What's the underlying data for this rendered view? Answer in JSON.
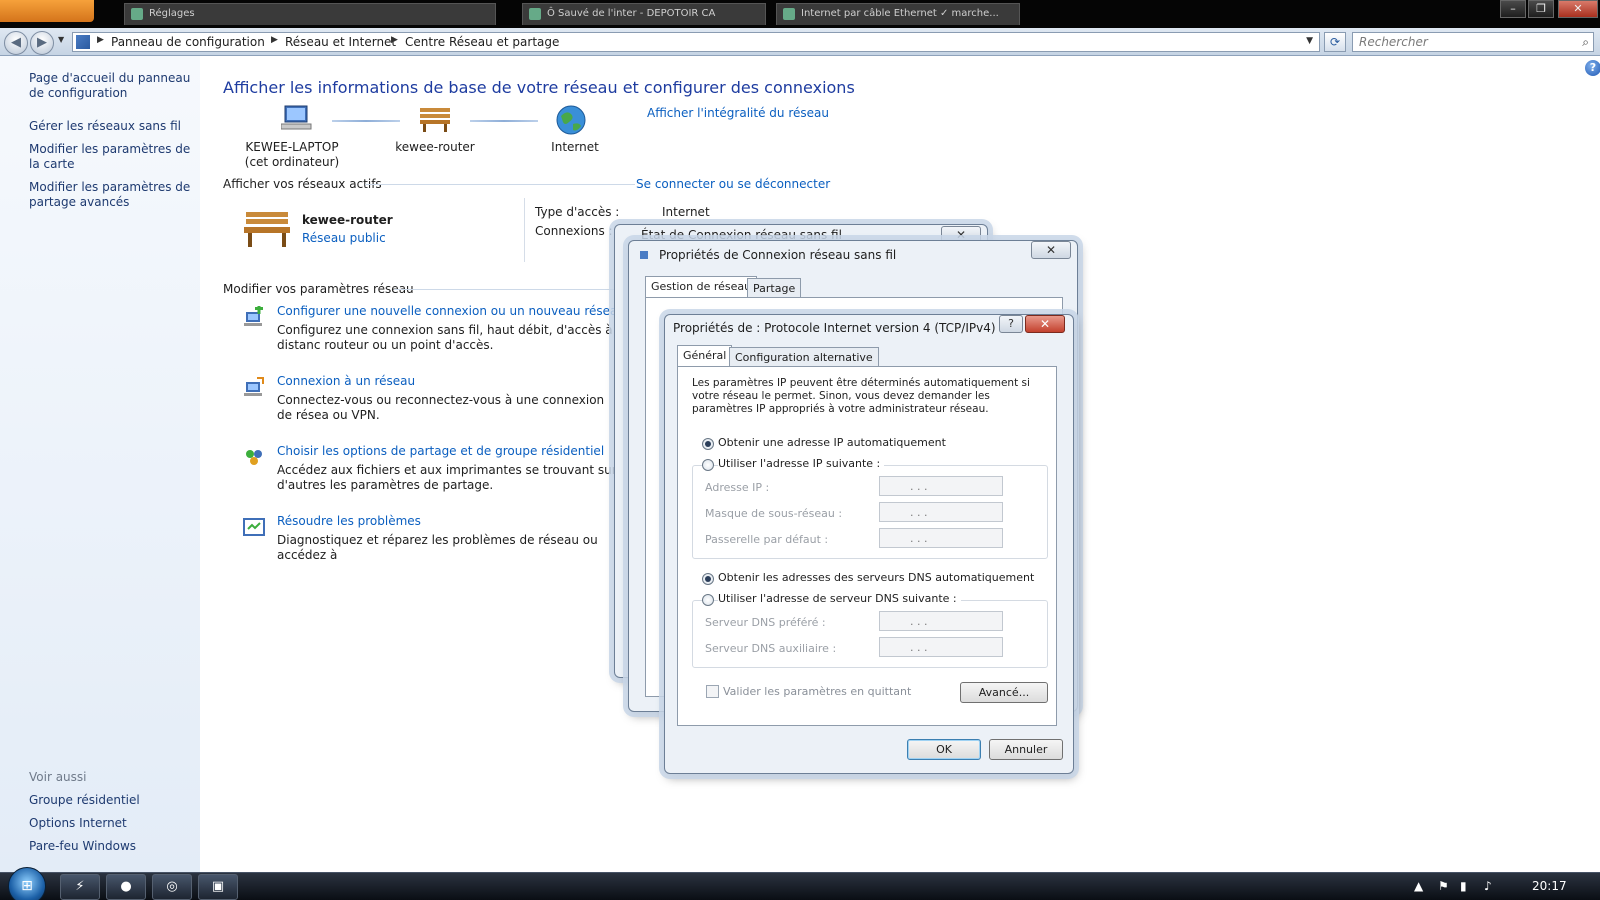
{
  "window_tabs": [
    {
      "label": "Réglages"
    },
    {
      "label": "Ô Sauvé de l'inter - DEPOTOIR  CA"
    },
    {
      "label": "Internet par câble Ethernet ✓ marche..."
    }
  ],
  "breadcrumb": [
    "Panneau de configuration",
    "Réseau et Internet",
    "Centre Réseau et partage"
  ],
  "search": {
    "placeholder": "Rechercher"
  },
  "left_panel": {
    "links": [
      "Page d'accueil du panneau de configuration",
      "Gérer les réseaux sans fil",
      "Modifier les paramètres de la carte",
      "Modifier les paramètres de partage avancés"
    ],
    "see_also_label": "Voir aussi",
    "see_also": [
      "Groupe résidentiel",
      "Options Internet",
      "Pare-feu Windows"
    ]
  },
  "main": {
    "title": "Afficher les informations de base de votre réseau et configurer des connexions",
    "view_full_map": "Afficher l'intégralité du réseau",
    "network_map": {
      "computer_name": "KEWEE-LAPTOP",
      "computer_sub": "(cet ordinateur)",
      "router": "kewee-router",
      "internet": "Internet"
    },
    "active_networks_header": "Afficher vos réseaux actifs",
    "connect_disconnect": "Se connecter ou se déconnecter",
    "active_network": {
      "name": "kewee-router",
      "type": "Réseau public",
      "access_type_label": "Type d'accès :",
      "access_type_value": "Internet",
      "connections_label": "Connexions :"
    },
    "modify_header": "Modifier vos paramètres réseau",
    "tasks": [
      {
        "link": "Configurer une nouvelle connexion ou un nouveau réseau",
        "desc": "Configurez une connexion sans fil, haut débit, d'accès à distanc routeur ou un point d'accès."
      },
      {
        "link": "Connexion à un réseau",
        "desc": "Connectez-vous ou reconnectez-vous à une connexion de résea ou VPN."
      },
      {
        "link": "Choisir les options de partage et de groupe résidentiel",
        "desc": "Accédez aux fichiers et aux imprimantes se trouvant sur d'autres les paramètres de partage."
      },
      {
        "link": "Résoudre les problèmes",
        "desc": "Diagnostiquez et réparez les problèmes de réseau ou accédez à"
      }
    ]
  },
  "dialog_status": {
    "title": "État de Connexion réseau sans fil"
  },
  "dialog_props": {
    "title": "Propriétés de Connexion réseau sans fil",
    "tabs": [
      "Gestion de réseau",
      "Partage"
    ]
  },
  "dialog_ipv4": {
    "title": "Propriétés de : Protocole Internet version 4 (TCP/IPv4)",
    "tabs": [
      "Général",
      "Configuration alternative"
    ],
    "intro": "Les paramètres IP peuvent être déterminés automatiquement si votre réseau le permet. Sinon, vous devez demander les paramètres IP appropriés à votre administrateur réseau.",
    "radio_ip_auto": "Obtenir une adresse IP automatiquement",
    "radio_ip_manual": "Utiliser l'adresse IP suivante :",
    "ip_address_label": "Adresse IP :",
    "subnet_label": "Masque de sous-réseau :",
    "gateway_label": "Passerelle par défaut :",
    "radio_dns_auto": "Obtenir les adresses des serveurs DNS automatiquement",
    "radio_dns_manual": "Utiliser l'adresse de serveur DNS suivante :",
    "dns_pref_label": "Serveur DNS préféré :",
    "dns_alt_label": "Serveur DNS auxiliaire :",
    "validate_label": "Valider les paramètres en quittant",
    "advanced_btn": "Avancé...",
    "ok_btn": "OK",
    "cancel_btn": "Annuler",
    "ip_dots": ". . ."
  },
  "taskbar": {
    "clock": "20:17"
  },
  "colors": {
    "link": "#0b5fc0",
    "title": "#1e3ca0"
  }
}
